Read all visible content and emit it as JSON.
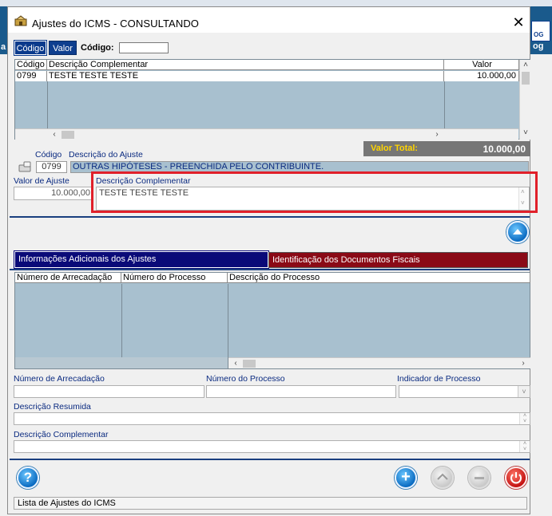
{
  "window": {
    "title": "Ajustes do ICMS  -  CONSULTANDO",
    "close": "✕"
  },
  "background": {
    "left_label": "a",
    "right_label_top": "OG",
    "right_label_bottom": "og"
  },
  "top_tabs": {
    "codigo": "Código",
    "valor": "Valor",
    "codigo_label": "Código:",
    "codigo_value": ""
  },
  "grid1": {
    "headers": [
      "Código",
      "Descrição Complementar",
      "Valor"
    ],
    "rows": [
      [
        "0799",
        "TESTE TESTE TESTE",
        "10.000,00"
      ]
    ]
  },
  "total": {
    "label": "Valor Total:",
    "value": "10.000,00"
  },
  "ajuste": {
    "codigo_label": "Código",
    "descricao_label": "Descrição do Ajuste",
    "codigo_value": "0799",
    "descricao_value": "OUTRAS HIPÓTESES - PREENCHIDA PELO CONTRIBUINTE.",
    "valor_label": "Valor de Ajuste",
    "valor_value": "10.000,00",
    "desc_comp_label": "Descrição Complementar",
    "desc_comp_value": "TESTE TESTE TESTE"
  },
  "tabs2": {
    "info": "Informações Adicionais dos Ajustes",
    "ident": "Identificação dos Documentos Fiscais"
  },
  "grid2": {
    "headers": [
      "Número de Arrecadação",
      "Número do Processo",
      "Descrição do Processo"
    ]
  },
  "fields": {
    "num_arrecadacao": "Número de Arrecadação",
    "num_processo": "Número do Processo",
    "indicador": "Indicador de Processo",
    "desc_resumida": "Descrição Resumida",
    "desc_complementar": "Descrição Complementar"
  },
  "buttons": {
    "help": "?",
    "add": "+"
  },
  "status": "Lista de Ajustes do ICMS",
  "colors": {
    "accent_blue": "#0a3a8c",
    "tab_red": "#8a0a16",
    "grid_bg": "#a8c0cf",
    "highlight": "#e0202a",
    "total_label": "#ffd400"
  }
}
